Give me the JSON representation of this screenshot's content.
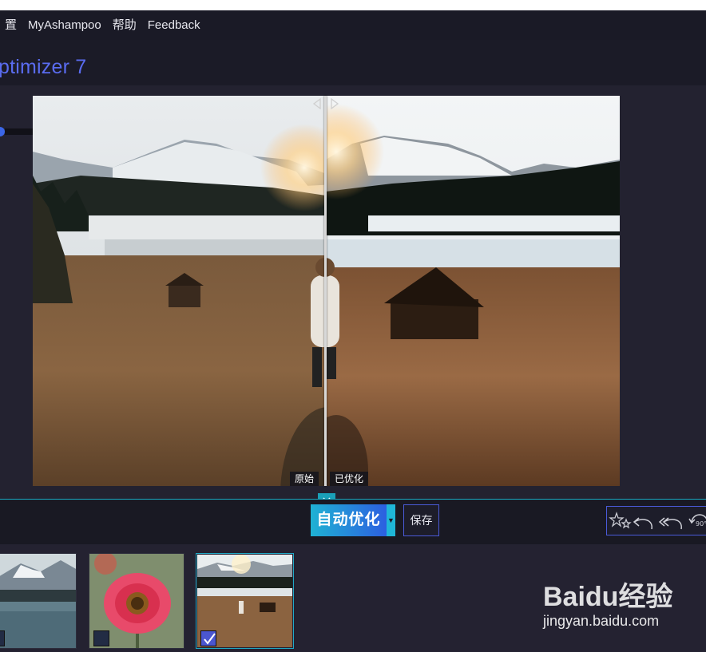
{
  "menu": {
    "items": [
      "置",
      "MyAshampoo",
      "帮助",
      "Feedback"
    ]
  },
  "app": {
    "title": "ptimizer 7"
  },
  "compare": {
    "original_label": "原始",
    "optimized_label": "已优化"
  },
  "toolbar": {
    "auto_optimize_label": "自动优化",
    "save_label": "保存",
    "rotate_label": "90°"
  },
  "filmstrip": {
    "thumbnails": [
      {
        "name": "lake-mountains",
        "checked": false
      },
      {
        "name": "flower",
        "checked": false
      },
      {
        "name": "mountain-girl",
        "checked": true
      }
    ]
  },
  "watermark": {
    "brand": "Baidu经验",
    "url": "jingyan.baidu.com"
  },
  "colors": {
    "accent_blue": "#3b66e6",
    "accent_cyan": "#1fb2d4",
    "title_blue": "#5a6cf0",
    "background": "#1e1d2b"
  }
}
